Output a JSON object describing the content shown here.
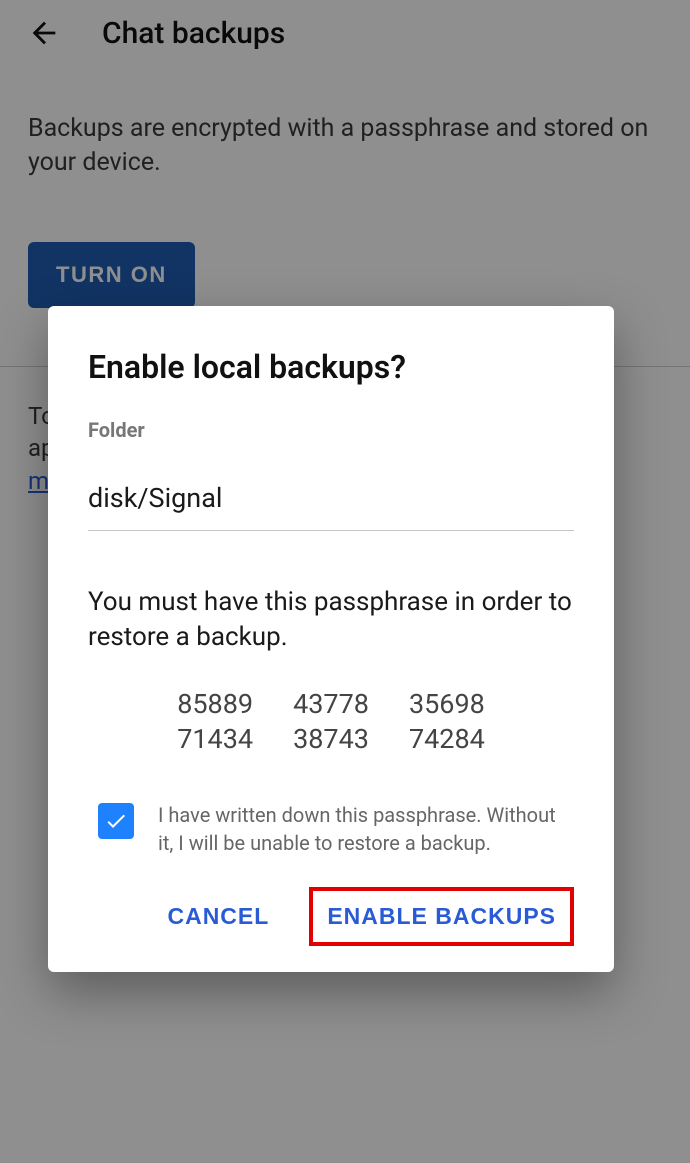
{
  "appbar": {
    "title": "Chat backups"
  },
  "page": {
    "description": "Backups are encrypted with a passphrase and stored on your device.",
    "turn_on_label": "TURN ON",
    "hint_prefix": "To",
    "hint_mid": "ap",
    "hint_link": "m"
  },
  "dialog": {
    "title": "Enable local backups?",
    "folder_label": "Folder",
    "folder_value": "disk/Signal",
    "instruction": "You must have this passphrase in order to restore a backup.",
    "passphrase": {
      "r1c1": "85889",
      "r1c2": "43778",
      "r1c3": "35698",
      "r2c1": "71434",
      "r2c2": "38743",
      "r2c3": "74284"
    },
    "confirm_text": "I have written down this passphrase. Without it, I will be unable to restore a backup.",
    "confirm_checked": true,
    "cancel_label": "CANCEL",
    "enable_label": "ENABLE BACKUPS"
  },
  "colors": {
    "accent": "#2a5bd7",
    "primary_button": "#1f5eb2",
    "checkbox": "#1e82ff",
    "highlight": "#e20000"
  }
}
